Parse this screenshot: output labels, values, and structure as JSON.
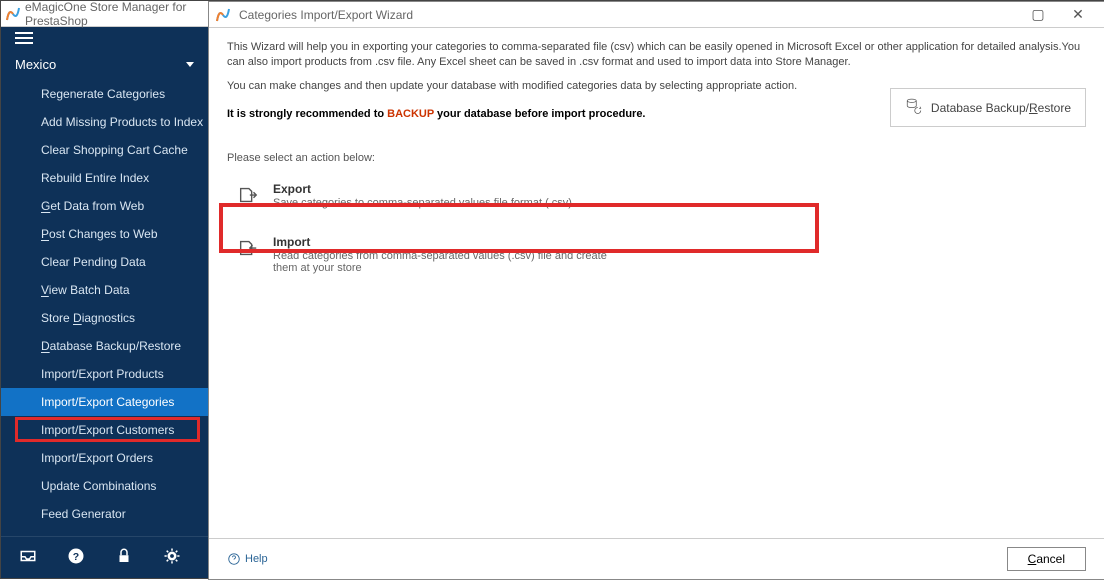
{
  "app": {
    "title": "eMagicOne Store Manager for PrestaShop"
  },
  "sidebar": {
    "section": "Mexico",
    "items": [
      {
        "pre": "",
        "u": "",
        "post": "Regenerate Categories"
      },
      {
        "pre": "",
        "u": "",
        "post": "Add Missing Products to Index"
      },
      {
        "pre": "",
        "u": "",
        "post": "Clear Shopping Cart Cache"
      },
      {
        "pre": "",
        "u": "",
        "post": "Rebuild Entire Index"
      },
      {
        "pre": "",
        "u": "G",
        "post": "et Data from Web"
      },
      {
        "pre": "",
        "u": "P",
        "post": "ost Changes to Web"
      },
      {
        "pre": "",
        "u": "",
        "post": "Clear Pending Data"
      },
      {
        "pre": "",
        "u": "V",
        "post": "iew Batch Data"
      },
      {
        "pre": "Store ",
        "u": "D",
        "post": "iagnostics"
      },
      {
        "pre": "",
        "u": "D",
        "post": "atabase Backup/Restore"
      },
      {
        "pre": "",
        "u": "",
        "post": "Import/Export Products"
      },
      {
        "pre": "",
        "u": "",
        "post": "Import/Export Categories"
      },
      {
        "pre": "",
        "u": "",
        "post": "Import/Export Customers"
      },
      {
        "pre": "",
        "u": "",
        "post": "Import/Export Orders"
      },
      {
        "pre": "",
        "u": "",
        "post": "Update Combinations"
      },
      {
        "pre": "",
        "u": "",
        "post": "Feed Generator"
      }
    ],
    "selected_index": 11
  },
  "wizard": {
    "title": "Categories Import/Export Wizard",
    "intro1": "This Wizard will help you in exporting your categories to comma-separated file (csv) which can be easily opened in Microsoft Excel or other application for detailed analysis.You can also import products from .csv file. Any Excel sheet can be saved in .csv format and used to import data into Store Manager.",
    "intro2": "You can make changes and then update your database with modified categories data by selecting appropriate action.",
    "recommend_pre": "It is strongly recommended to ",
    "recommend_word": "BACKUP",
    "recommend_post": " your database before import procedure.",
    "backup_btn_pre": "Database Backup/",
    "backup_btn_u": "R",
    "backup_btn_post": "estore",
    "please_select": "Please select an action below:",
    "actions": [
      {
        "title": "Export",
        "desc": "Save categories to comma-separated values file format (.csv)"
      },
      {
        "title": "Import",
        "desc": "Read categories from comma-separated values (.csv) file and create them at your store"
      }
    ],
    "help": "Help",
    "cancel_pre": "",
    "cancel_u": "C",
    "cancel_post": "ancel"
  }
}
